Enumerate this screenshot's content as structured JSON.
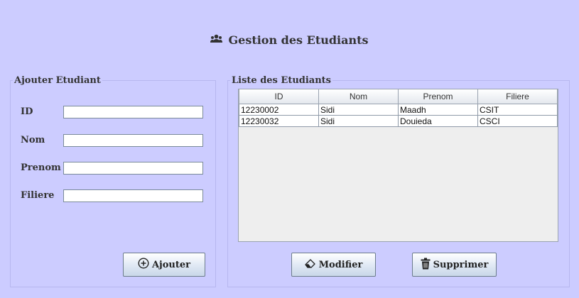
{
  "header": {
    "title": "Gestion des Etudiants",
    "icon": "users-icon"
  },
  "left_panel": {
    "legend": "Ajouter Etudiant",
    "fields": [
      {
        "label": "ID",
        "value": ""
      },
      {
        "label": "Nom",
        "value": ""
      },
      {
        "label": "Prenom",
        "value": ""
      },
      {
        "label": "Filiere",
        "value": ""
      }
    ],
    "add_button": {
      "label": "Ajouter",
      "icon": "plus-circle-icon"
    }
  },
  "right_panel": {
    "legend": "Liste des Etudiants",
    "table": {
      "columns": [
        "ID",
        "Nom",
        "Prenom",
        "Filiere"
      ],
      "rows": [
        [
          "12230002",
          "Sidi",
          "Maadh",
          "CSIT"
        ],
        [
          "12230032",
          "Sidi",
          "Douieda",
          "CSCI"
        ]
      ]
    },
    "modify_button": {
      "label": "Modifier",
      "icon": "eraser-icon"
    },
    "delete_button": {
      "label": "Supprimer",
      "icon": "trash-icon"
    }
  }
}
